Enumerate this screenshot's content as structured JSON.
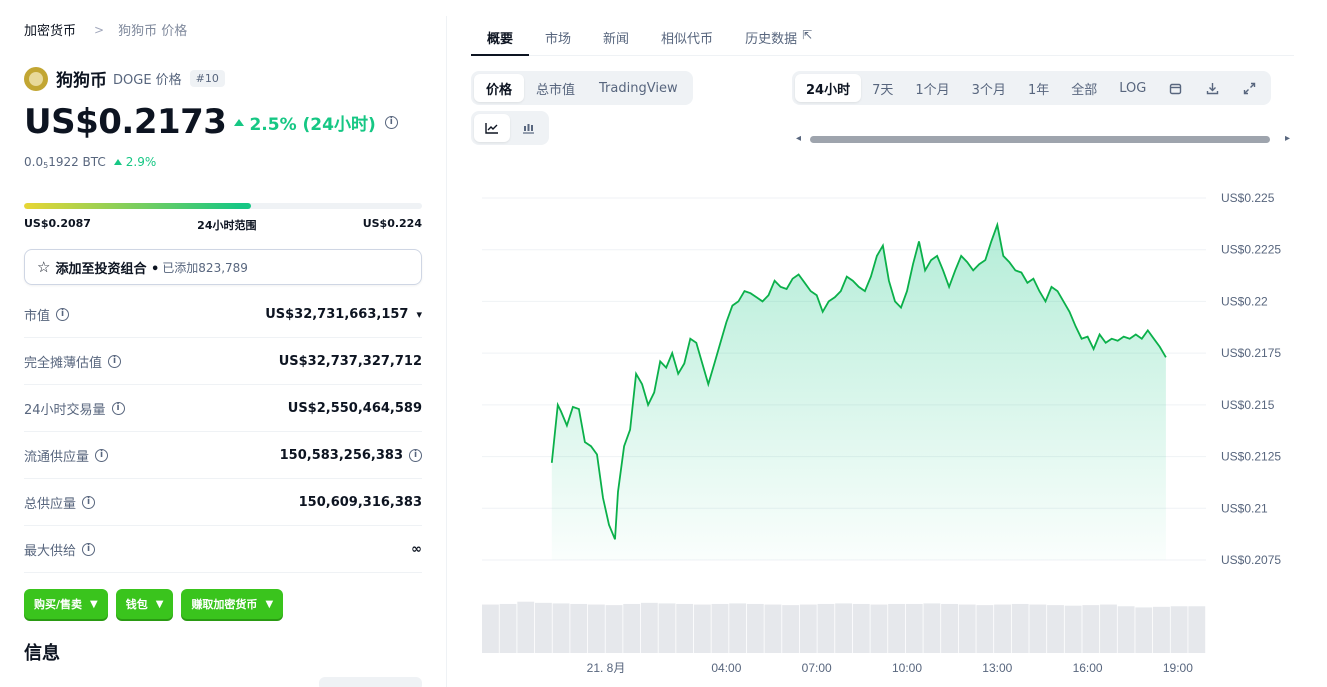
{
  "breadcrumb": {
    "root": "加密货币",
    "current": "狗狗币 价格"
  },
  "coin": {
    "name": "狗狗币",
    "symbol_label": "DOGE 价格",
    "rank": "#10",
    "price": "US$0.2173",
    "change_24h": "2.5% (24小时)",
    "btc_price_prefix": "0.0",
    "btc_price_sub": "5",
    "btc_price_rest": "1922 BTC",
    "btc_change": "2.9%"
  },
  "range": {
    "low": "US$0.2087",
    "label": "24小时范围",
    "high": "US$0.224",
    "position_fraction": 0.57
  },
  "watchlist": {
    "label": "添加至投资组合 •",
    "count": "已添加823,789"
  },
  "stats": [
    {
      "key": "市值",
      "value": "US$32,731,663,157"
    },
    {
      "key": "完全摊薄估值",
      "value": "US$32,737,327,712"
    },
    {
      "key": "24小时交易量",
      "value": "US$2,550,464,589"
    },
    {
      "key": "流通供应量",
      "value": "150,583,256,383"
    },
    {
      "key": "总供应量",
      "value": "150,609,316,383"
    },
    {
      "key": "最大供给",
      "value": "∞"
    }
  ],
  "actions": [
    "购买/售卖",
    "钱包",
    "赚取加密货币"
  ],
  "info_title": "信息",
  "tabs": [
    "概要",
    "市场",
    "新闻",
    "相似代币",
    "历史数据"
  ],
  "chart_type_options": [
    "价格",
    "总市值",
    "TradingView"
  ],
  "range_options": [
    "24小时",
    "7天",
    "1个月",
    "3个月",
    "1年",
    "全部",
    "LOG"
  ],
  "icons": [
    "line-chart-icon",
    "candlestick-icon",
    "calendar-icon",
    "download-icon",
    "expand-icon",
    "external-link-icon",
    "star-icon",
    "info-icon",
    "chevron-down-icon"
  ],
  "colors": {
    "accent_green": "#16c784",
    "line_green": "#0bb04a",
    "button_green": "#3ac41d",
    "text_dark": "#0d1421",
    "text_muted": "#58667e"
  },
  "chart_data": {
    "type": "area",
    "ylim": [
      0.2065,
      0.2262
    ],
    "yticks": [
      "US$0.225",
      "US$0.2225",
      "US$0.22",
      "US$0.2175",
      "US$0.215",
      "US$0.2125",
      "US$0.21",
      "US$0.2075"
    ],
    "ytick_values": [
      0.225,
      0.2225,
      0.22,
      0.2175,
      0.215,
      0.2125,
      0.21,
      0.2075
    ],
    "xticks": [
      "21. 8月",
      "04:00",
      "07:00",
      "10:00",
      "13:00",
      "16:00",
      "19:00"
    ],
    "xtick_hours": [
      0,
      4,
      7,
      10,
      13,
      16,
      19
    ],
    "x_hours": [
      -1.8,
      -1.6,
      -1.5,
      -1.3,
      -1.1,
      -0.9,
      -0.7,
      -0.5,
      -0.3,
      -0.1,
      0.1,
      0.3,
      0.4,
      0.6,
      0.8,
      1.0,
      1.2,
      1.4,
      1.6,
      1.8,
      2.0,
      2.2,
      2.4,
      2.6,
      2.8,
      3.0,
      3.2,
      3.4,
      3.6,
      3.8,
      4.0,
      4.2,
      4.4,
      4.6,
      4.8,
      5.0,
      5.2,
      5.4,
      5.6,
      5.8,
      6.0,
      6.2,
      6.4,
      6.6,
      6.8,
      7.0,
      7.2,
      7.4,
      7.6,
      7.8,
      8.0,
      8.2,
      8.4,
      8.6,
      8.8,
      9.0,
      9.2,
      9.4,
      9.6,
      9.8,
      10.0,
      10.2,
      10.4,
      10.6,
      10.8,
      11.0,
      11.2,
      11.4,
      11.6,
      11.8,
      12.0,
      12.2,
      12.4,
      12.6,
      12.8,
      13.0,
      13.2,
      13.4,
      13.6,
      13.8,
      14.0,
      14.2,
      14.4,
      14.6,
      14.8,
      15.0,
      15.2,
      15.4,
      15.6,
      15.8,
      16.0,
      16.2,
      16.4,
      16.6,
      16.8,
      17.0,
      17.2,
      17.4,
      17.6,
      17.8,
      18.0,
      18.2,
      18.4,
      18.6,
      18.8,
      19.0,
      19.2,
      19.4,
      19.6,
      19.8,
      20.0,
      20.2,
      20.4,
      20.6,
      20.8,
      21.0,
      21.2,
      21.4
    ],
    "values": [
      0.2122,
      0.215,
      0.2147,
      0.214,
      0.2149,
      0.2148,
      0.2132,
      0.213,
      0.2126,
      0.2105,
      0.2092,
      0.2085,
      0.2108,
      0.213,
      0.2138,
      0.2165,
      0.216,
      0.215,
      0.2156,
      0.2171,
      0.2168,
      0.2175,
      0.2165,
      0.217,
      0.2182,
      0.218,
      0.217,
      0.216,
      0.217,
      0.218,
      0.219,
      0.2198,
      0.22,
      0.2205,
      0.2204,
      0.2202,
      0.22,
      0.2203,
      0.221,
      0.2207,
      0.2206,
      0.2211,
      0.2213,
      0.2209,
      0.2205,
      0.2203,
      0.2195,
      0.22,
      0.2202,
      0.2205,
      0.2212,
      0.221,
      0.2207,
      0.2205,
      0.2212,
      0.2222,
      0.2227,
      0.221,
      0.22,
      0.2197,
      0.2205,
      0.2218,
      0.2229,
      0.2215,
      0.222,
      0.2222,
      0.2215,
      0.2207,
      0.2215,
      0.2222,
      0.2219,
      0.2215,
      0.2218,
      0.222,
      0.2229,
      0.2237,
      0.2222,
      0.2219,
      0.2215,
      0.2214,
      0.2209,
      0.2211,
      0.2205,
      0.22,
      0.2207,
      0.2205,
      0.22,
      0.2195,
      0.2188,
      0.2182,
      0.2183,
      0.2177,
      0.2184,
      0.218,
      0.2182,
      0.2181,
      0.2183,
      0.2182,
      0.2184,
      0.2182,
      0.2186,
      0.2182,
      0.2178,
      0.2173
    ],
    "volume_relative": [
      0.85,
      0.86,
      0.9,
      0.88,
      0.87,
      0.86,
      0.85,
      0.84,
      0.86,
      0.88,
      0.87,
      0.86,
      0.85,
      0.86,
      0.87,
      0.86,
      0.85,
      0.84,
      0.85,
      0.86,
      0.87,
      0.86,
      0.85,
      0.86,
      0.86,
      0.87,
      0.86,
      0.85,
      0.84,
      0.85,
      0.86,
      0.85,
      0.84,
      0.83,
      0.84,
      0.85,
      0.82,
      0.8,
      0.81,
      0.82,
      0.82
    ]
  }
}
